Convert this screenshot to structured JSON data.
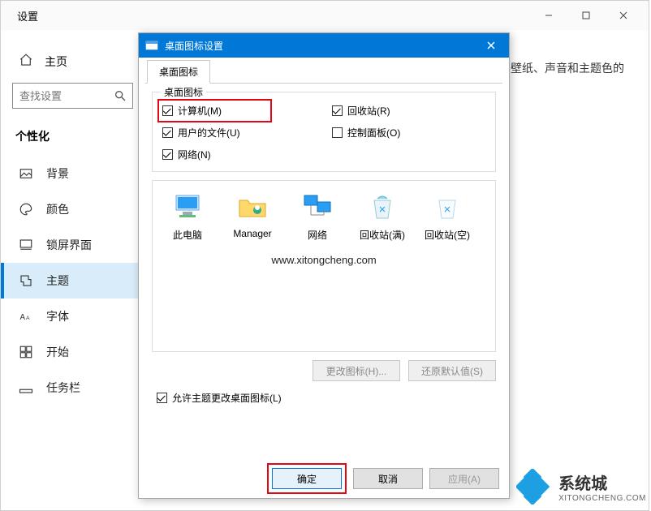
{
  "settings": {
    "title": "设置",
    "home_label": "主页",
    "search_placeholder": "查找设置",
    "category": "个性化",
    "nav": [
      {
        "label": "背景",
        "icon": "image-icon"
      },
      {
        "label": "颜色",
        "icon": "palette-icon"
      },
      {
        "label": "锁屏界面",
        "icon": "lock-icon"
      },
      {
        "label": "主题",
        "icon": "theme-icon",
        "active": true
      },
      {
        "label": "字体",
        "icon": "font-icon"
      },
      {
        "label": "开始",
        "icon": "start-icon"
      },
      {
        "label": "任务栏",
        "icon": "taskbar-icon"
      }
    ],
    "main_fragment": "壁纸、声音和主题色的"
  },
  "dialog": {
    "title": "桌面图标设置",
    "tab_label": "桌面图标",
    "group_label": "桌面图标",
    "checkboxes": {
      "computer": {
        "label": "计算机(M)",
        "checked": true,
        "highlighted": true
      },
      "recycle": {
        "label": "回收站(R)",
        "checked": true
      },
      "userfiles": {
        "label": "用户的文件(U)",
        "checked": true
      },
      "cpanel": {
        "label": "控制面板(O)",
        "checked": false
      },
      "network": {
        "label": "网络(N)",
        "checked": true
      }
    },
    "icons": [
      {
        "label": "此电脑",
        "name": "this-pc-icon"
      },
      {
        "label": "Manager",
        "name": "user-folder-icon"
      },
      {
        "label": "网络",
        "name": "network-icon"
      },
      {
        "label": "回收站(满)",
        "name": "recycle-full-icon"
      },
      {
        "label": "回收站(空)",
        "name": "recycle-empty-icon"
      }
    ],
    "watermark": "www.xitongcheng.com",
    "change_icon_label": "更改图标(H)...",
    "restore_default_label": "还原默认值(S)",
    "allow_themes_label": "允许主题更改桌面图标(L)",
    "allow_themes_checked": true,
    "ok_label": "确定",
    "cancel_label": "取消",
    "apply_label": "应用(A)"
  },
  "brand": {
    "zh": "系统城",
    "en": "XITONGCHENG.COM"
  }
}
